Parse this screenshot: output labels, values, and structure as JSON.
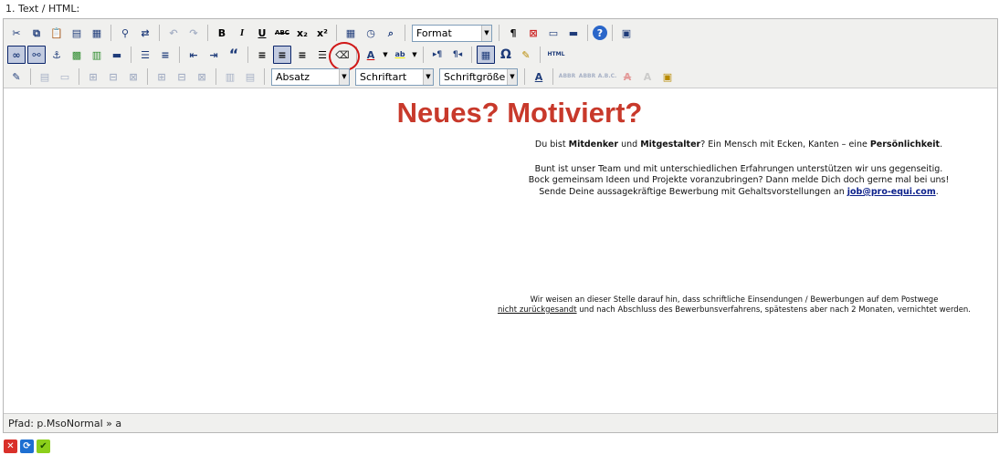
{
  "field": {
    "label": "1. Text / HTML:"
  },
  "toolbar": {
    "row1": {
      "format_select": "Format",
      "buttons": {
        "bold": "B",
        "italic": "I",
        "underline": "U",
        "strike": "ABC",
        "subscript": "x₂",
        "superscript": "x²",
        "paragraph": "¶"
      }
    },
    "row2": {
      "quote": "“",
      "omega": "Ω",
      "html": "HTML"
    },
    "row3": {
      "block_select": "Absatz",
      "font_select": "Schriftart",
      "size_select": "Schriftgröße"
    }
  },
  "content": {
    "headline": "Neues? Motiviert?",
    "p1": {
      "a": "Du bist ",
      "b1": "Mitdenker",
      "c": " und ",
      "b2": "Mitgestalter",
      "d": "? Ein Mensch mit Ecken, Kanten – eine ",
      "b3": "Persönlichkeit",
      "e": "."
    },
    "p2_line1": "Bunt ist unser Team und mit unterschiedlichen Erfahrungen unterstützen wir uns gegenseitig.",
    "p2_line2": "Bock gemeinsam Ideen und Projekte voranzubringen? Dann melde Dich doch gerne mal bei uns!",
    "p3": {
      "text": "Sende Deine aussagekräftige Bewerbung mit Gehaltsvorstellungen an ",
      "email": "job@pro-equi.com",
      "end": "."
    },
    "foot_line1": "Wir weisen an dieser Stelle darauf hin, dass schriftliche Einsendungen / Bewerbungen auf dem Postwege",
    "foot_underlined": "nicht zurückgesandt",
    "foot_line2_rest": " und nach Abschluss des Bewerbunsverfahrens, spätestens aber nach 2 Monaten, vernichtet werden."
  },
  "pathbar": {
    "text": "Pfad: p.MsoNormal » a"
  },
  "colors": {
    "headline": "#c8392b",
    "link": "#0b1f8a",
    "highlight": "#d01818"
  }
}
